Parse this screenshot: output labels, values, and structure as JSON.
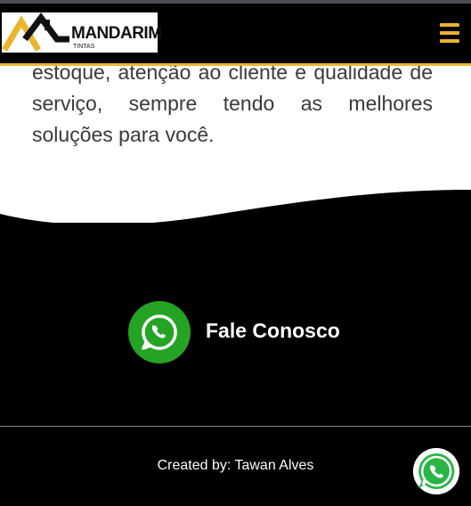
{
  "brand": {
    "name": "MANDARIM",
    "sub": "TINTAS",
    "accent_color": "#e9b52e"
  },
  "header": {
    "menu_icon": "hamburger-menu-icon"
  },
  "about": {
    "paragraph": "estoque, atenção ao cliente e qualidade de serviço, sempre tendo as melhores soluções para você."
  },
  "contact": {
    "label": "Fale Conosco",
    "icon": "whatsapp-icon",
    "icon_color": "#25a325"
  },
  "footer": {
    "credit": "Created by: Tawan Alves"
  },
  "floating_button": {
    "icon": "whatsapp-icon"
  }
}
